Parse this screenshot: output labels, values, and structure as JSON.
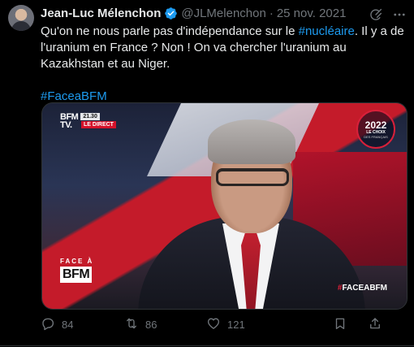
{
  "tweet": {
    "author_name": "Jean-Luc Mélenchon",
    "handle": "@JLMelenchon",
    "separator": "·",
    "date": "25 nov. 2021",
    "text_before_link": "Qu'on ne nous parle pas d'indépendance sur le ",
    "link_hashtag": "#nucléaire",
    "text_after_link": ". Il y a de l'uranium en France ? Non ! On va chercher l'uranium au Kazakhstan et au Niger.",
    "hashtag": "#FaceaBFM",
    "link_color": "#1d9bf0",
    "verified_color": "#1d9bf0"
  },
  "media": {
    "channel_mark": "BFM\nTV.",
    "time": "21.30",
    "live_label": "LE DIRECT",
    "badge_year": "2022",
    "badge_line1": "LE CHOIX",
    "badge_line2": "DES FRANÇAIS",
    "show_top": "FACE À",
    "show_bottom": "BFM",
    "overlay_hash": "#",
    "overlay_tag": "FACEABFM"
  },
  "actions": {
    "reply_count": "84",
    "retweet_count": "86",
    "like_count": "121"
  },
  "icons": {
    "verified": "verified-badge-icon",
    "grok": "grok-icon",
    "more": "more-icon",
    "reply": "reply-icon",
    "retweet": "retweet-icon",
    "like": "like-icon",
    "bookmark": "bookmark-icon",
    "share": "share-icon"
  }
}
